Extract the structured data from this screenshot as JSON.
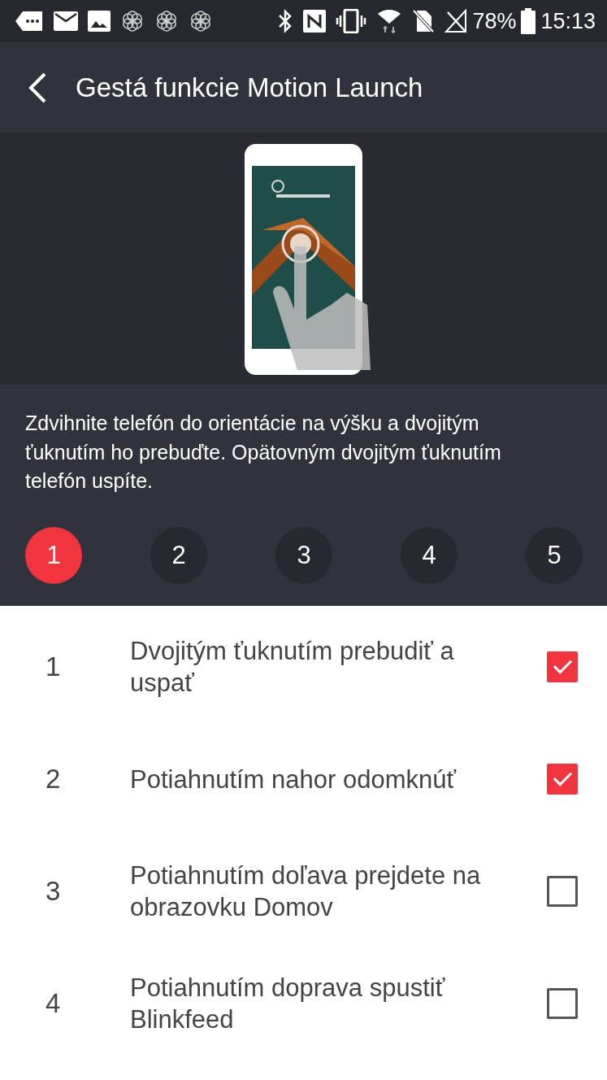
{
  "status_bar": {
    "battery": "78%",
    "time": "15:13"
  },
  "header": {
    "title": "Gestá funkcie Motion Launch"
  },
  "description": "Zdvihnite telefón do orientácie na výšku a dvojitým ťuknutím ho prebuďte. Opätovným dvojitým ťuknutím telefón uspíte.",
  "steps": [
    {
      "label": "1",
      "selected": true
    },
    {
      "label": "2",
      "selected": false
    },
    {
      "label": "3",
      "selected": false
    },
    {
      "label": "4",
      "selected": false
    },
    {
      "label": "5",
      "selected": false
    }
  ],
  "gestures": [
    {
      "number": "1",
      "label": "Dvojitým ťuknutím prebudiť a uspať",
      "checked": true
    },
    {
      "number": "2",
      "label": "Potiahnutím nahor odomknúť",
      "checked": true
    },
    {
      "number": "3",
      "label": "Potiahnutím doľava prejdete na obrazovku Domov",
      "checked": false
    },
    {
      "number": "4",
      "label": "Potiahnutím doprava spustiť Blinkfeed",
      "checked": false
    }
  ]
}
